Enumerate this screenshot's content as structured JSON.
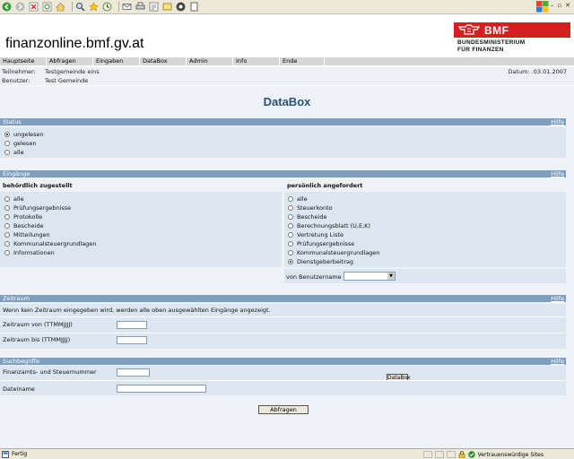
{
  "site_title": "finanzonline.bmf.gv.at",
  "logo": {
    "name": "BMF",
    "sub_line1": "BUNDESMINISTERIUM",
    "sub_line2": "FÜR FINANZEN"
  },
  "nav": [
    "Hauptseite",
    "Abfragen",
    "Eingaben",
    "DataBox",
    "Admin",
    "Info",
    "Ende"
  ],
  "info": {
    "teilnehmer_label": "Teilnehmer:",
    "teilnehmer_value": "Testgemeinde eins",
    "benutzer_label": "Benutzer:",
    "benutzer_value": "Test Gemeinde",
    "datum_label": "Datum:",
    "datum_value": "03.01.2007"
  },
  "page_heading": "DataBox",
  "help_label": "Hilfe",
  "status": {
    "title": "Status",
    "options": [
      {
        "label": "ungelesen",
        "checked": true
      },
      {
        "label": "gelesen",
        "checked": false
      },
      {
        "label": "alle",
        "checked": false
      }
    ]
  },
  "eingaenge": {
    "title": "Eingänge",
    "left_heading": "behördlich zugestellt",
    "left_options": [
      {
        "label": "alle",
        "checked": false
      },
      {
        "label": "Prüfungsergebnisse",
        "checked": false
      },
      {
        "label": "Protokolle",
        "checked": false
      },
      {
        "label": "Bescheide",
        "checked": false
      },
      {
        "label": "Mitteilungen",
        "checked": false
      },
      {
        "label": "Kommunalsteuergrundlagen",
        "checked": false
      },
      {
        "label": "Informationen",
        "checked": false
      }
    ],
    "right_heading": "persönlich angefordert",
    "right_options": [
      {
        "label": "alle",
        "checked": false
      },
      {
        "label": "Steuerkonto",
        "checked": false
      },
      {
        "label": "Bescheide",
        "checked": false
      },
      {
        "label": "Berechnungsblatt (U,E,K)",
        "checked": false
      },
      {
        "label": "Vertretung Liste",
        "checked": false
      },
      {
        "label": "Prüfungsergebnisse",
        "checked": false
      },
      {
        "label": "Kommunalsteuergrundlagen",
        "checked": false
      },
      {
        "label": "Dienstgeberbeitrag",
        "checked": true
      }
    ],
    "von_benutzername_label": "von Benutzername",
    "von_benutzername_value": ""
  },
  "zeitraum": {
    "title": "Zeitraum",
    "note": "Wenn kein Zeitraum eingegeben wird, werden alle oben ausgewählten Eingänge angezeigt.",
    "von_label": "Zeitraum von (TTMMJJJJ)",
    "von_value": "",
    "bis_label": "Zeitraum bis (TTMMJJJJ)",
    "bis_value": ""
  },
  "suchbegriffe": {
    "title": "Suchbegriffe",
    "steuernummer_label": "Finanzamts- und Steuernummer",
    "steuernummer_value": "",
    "dateiname_label": "Dateiname",
    "dateiname_value": "",
    "databox_button": "DataBox"
  },
  "submit_button": "Abfragen",
  "statusbar": {
    "left": "Fertig",
    "right": "Vertrauenswürdige Sites"
  }
}
